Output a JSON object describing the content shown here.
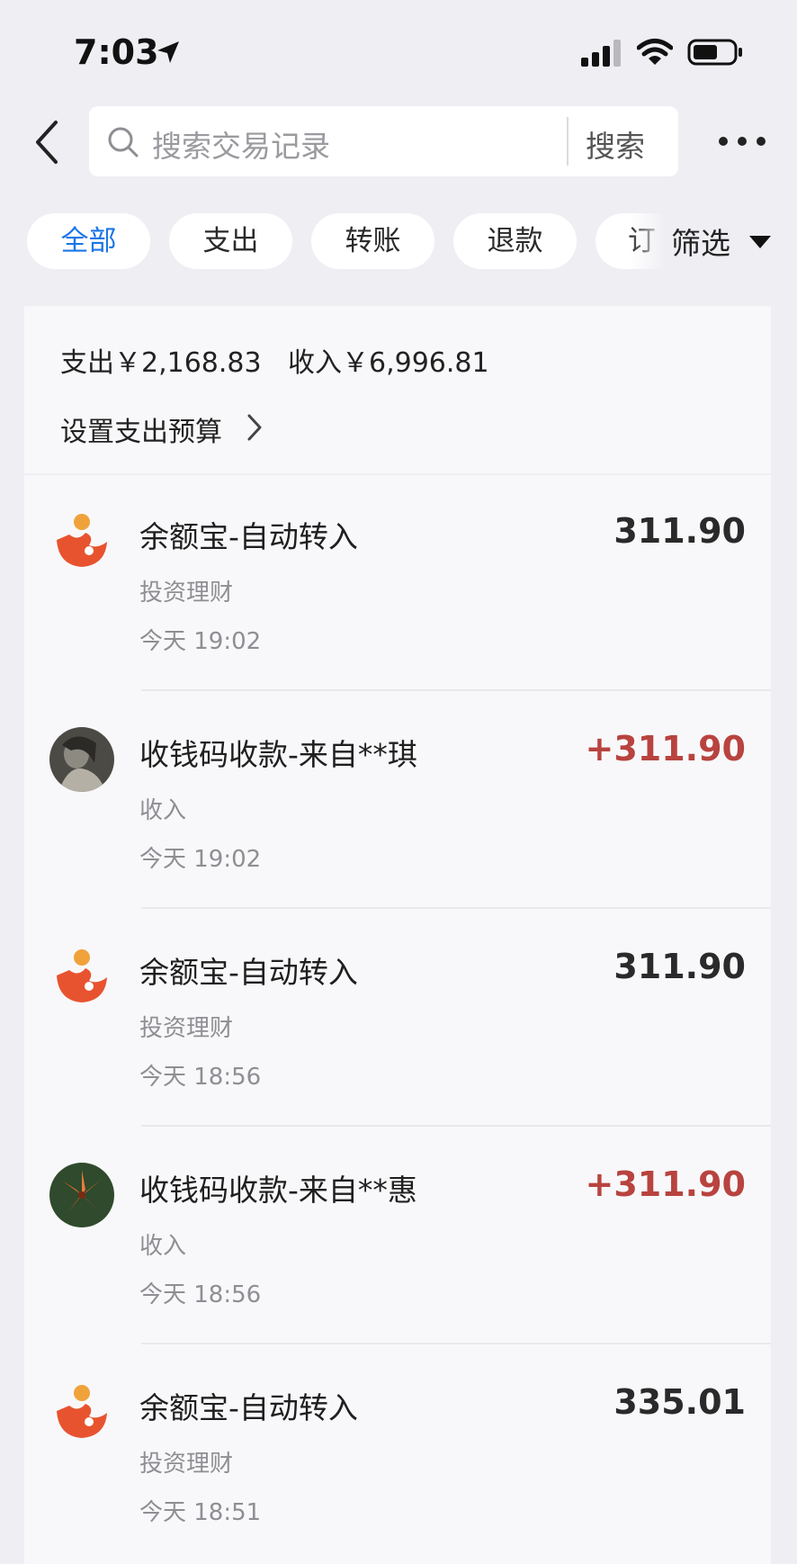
{
  "status_bar": {
    "time": "7:03"
  },
  "search": {
    "placeholder": "搜索交易记录",
    "button": "搜索"
  },
  "tabs": [
    {
      "label": "全部",
      "active": true
    },
    {
      "label": "支出",
      "active": false
    },
    {
      "label": "转账",
      "active": false
    },
    {
      "label": "退款",
      "active": false
    },
    {
      "label": "订",
      "active": false
    }
  ],
  "filter": {
    "label": "筛选"
  },
  "summary": {
    "expense": "支出￥2,168.83",
    "income": "收入￥6,996.81",
    "budget_link": "设置支出预算"
  },
  "transactions": [
    {
      "title": "余额宝-自动转入",
      "category": "投资理财",
      "time": "今天 19:02",
      "amount": "311.90",
      "type": "transfer",
      "icon": "yuebao-icon"
    },
    {
      "title": "收钱码收款-来自**琪",
      "category": "收入",
      "time": "今天 19:02",
      "amount": "+311.90",
      "type": "income",
      "icon": "user-avatar-photo"
    },
    {
      "title": "余额宝-自动转入",
      "category": "投资理财",
      "time": "今天 18:56",
      "amount": "311.90",
      "type": "transfer",
      "icon": "yuebao-icon"
    },
    {
      "title": "收钱码收款-来自**惠",
      "category": "收入",
      "time": "今天 18:56",
      "amount": "+311.90",
      "type": "income",
      "icon": "user-avatar-flower"
    },
    {
      "title": "余额宝-自动转入",
      "category": "投资理财",
      "time": "今天 18:51",
      "amount": "335.01",
      "type": "transfer",
      "icon": "yuebao-icon"
    }
  ],
  "colors": {
    "accent": "#1b77e6",
    "income": "#b8433f",
    "background": "#efeef3",
    "yuebao_orange": "#e8532f"
  }
}
